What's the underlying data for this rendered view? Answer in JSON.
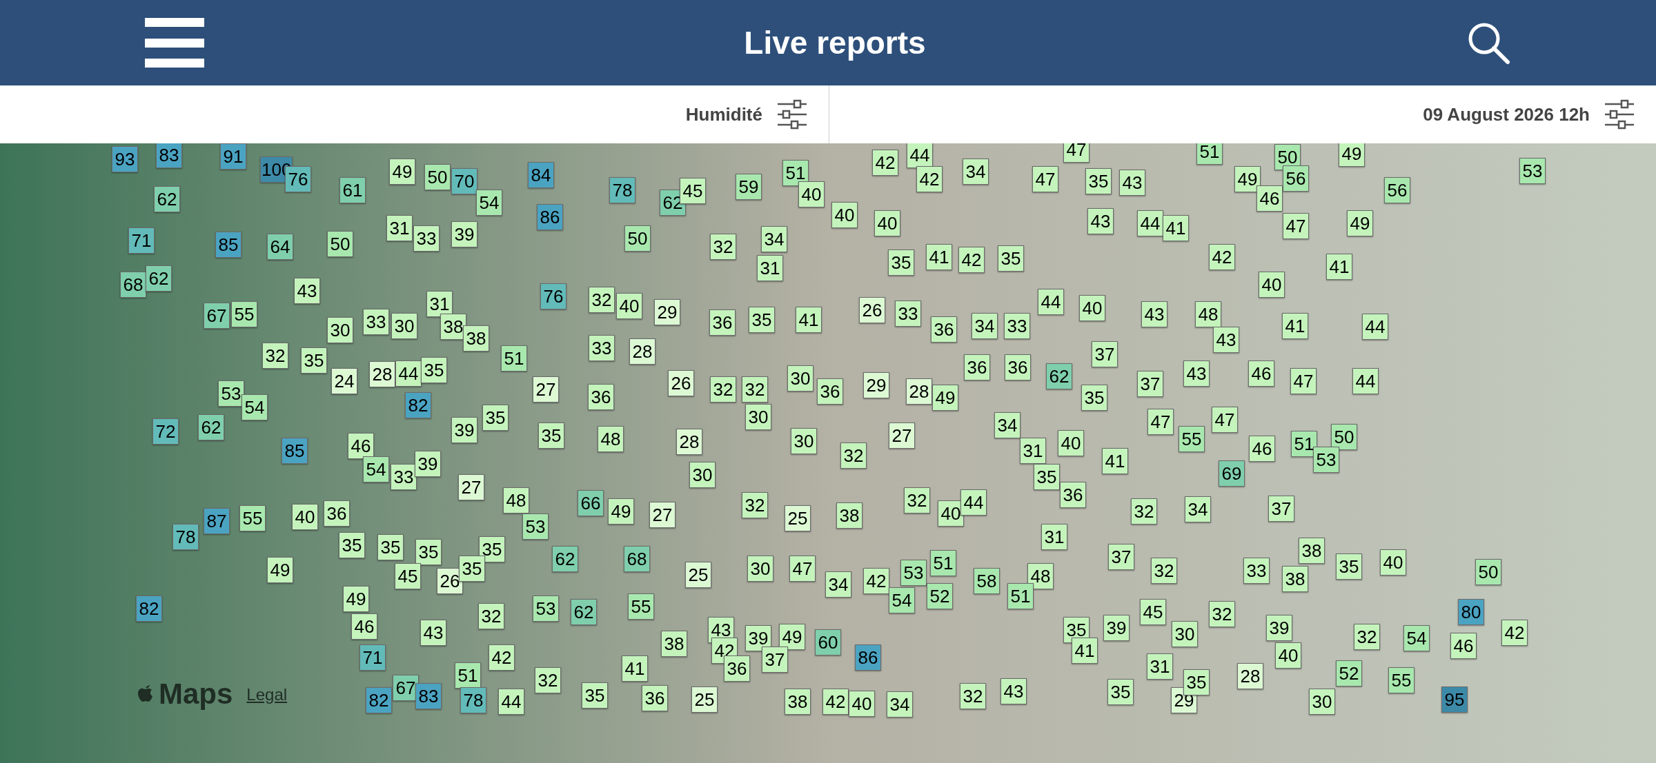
{
  "header": {
    "title": "Live reports"
  },
  "filters": [
    {
      "label": "Humidité"
    },
    {
      "label": "09 August 2026 12h"
    }
  ],
  "humidity_markers": [
    "93",
    "83",
    "91",
    "100",
    "76",
    "61",
    "49",
    "50",
    "70",
    "54",
    "84",
    "86",
    "78",
    "62",
    "45",
    "59",
    "51",
    "40",
    "42",
    "44",
    "42",
    "34",
    "47",
    "47",
    "35",
    "43",
    "51",
    "50",
    "49",
    "56",
    "46",
    "49",
    "56",
    "53",
    "62",
    "71",
    "85",
    "64",
    "50",
    "31",
    "33",
    "39",
    "50",
    "32",
    "34",
    "31",
    "40",
    "40",
    "43",
    "44",
    "41",
    "47",
    "49",
    "35",
    "41",
    "42",
    "35",
    "42",
    "68",
    "62",
    "43",
    "76",
    "32",
    "40",
    "29",
    "36",
    "35",
    "41",
    "26",
    "33",
    "36",
    "34",
    "33",
    "44",
    "40",
    "43",
    "48",
    "40",
    "41",
    "43",
    "41",
    "44",
    "67",
    "55",
    "31",
    "38",
    "38",
    "30",
    "33",
    "30",
    "32",
    "35",
    "51",
    "33",
    "28",
    "24",
    "28",
    "44",
    "35",
    "53",
    "54",
    "27",
    "36",
    "26",
    "32",
    "32",
    "30",
    "36",
    "29",
    "28",
    "49",
    "36",
    "36",
    "62",
    "37",
    "35",
    "37",
    "43",
    "46",
    "47",
    "44",
    "82",
    "72",
    "62",
    "39",
    "35",
    "35",
    "48",
    "28",
    "30",
    "30",
    "32",
    "27",
    "34",
    "31",
    "40",
    "41",
    "47",
    "55",
    "47",
    "46",
    "51",
    "50",
    "53",
    "85",
    "46",
    "54",
    "33",
    "39",
    "35",
    "36",
    "69",
    "27",
    "48",
    "53",
    "66",
    "49",
    "27",
    "30",
    "32",
    "25",
    "38",
    "32",
    "40",
    "44",
    "87",
    "55",
    "40",
    "36",
    "78",
    "32",
    "34",
    "37",
    "35",
    "35",
    "35",
    "35",
    "49",
    "45",
    "26",
    "35",
    "62",
    "68",
    "25",
    "30",
    "47",
    "34",
    "42",
    "53",
    "51",
    "58",
    "48",
    "54",
    "52",
    "51",
    "31",
    "37",
    "32",
    "33",
    "38",
    "38",
    "35",
    "40",
    "50",
    "82",
    "49",
    "32",
    "53",
    "62",
    "55",
    "45",
    "32",
    "80",
    "46",
    "43",
    "38",
    "43",
    "39",
    "49",
    "60",
    "35",
    "39",
    "30",
    "39",
    "32",
    "54",
    "46",
    "42",
    "71",
    "42",
    "41",
    "42",
    "36",
    "37",
    "86",
    "41",
    "31",
    "40",
    "82",
    "67",
    "83",
    "51",
    "78",
    "44",
    "32",
    "35",
    "36",
    "25",
    "38",
    "42",
    "40",
    "34",
    "32",
    "43",
    "35",
    "29",
    "35",
    "28",
    "30",
    "52",
    "55",
    "95"
  ],
  "attribution": {
    "brand": "Maps",
    "link": "Legal"
  }
}
